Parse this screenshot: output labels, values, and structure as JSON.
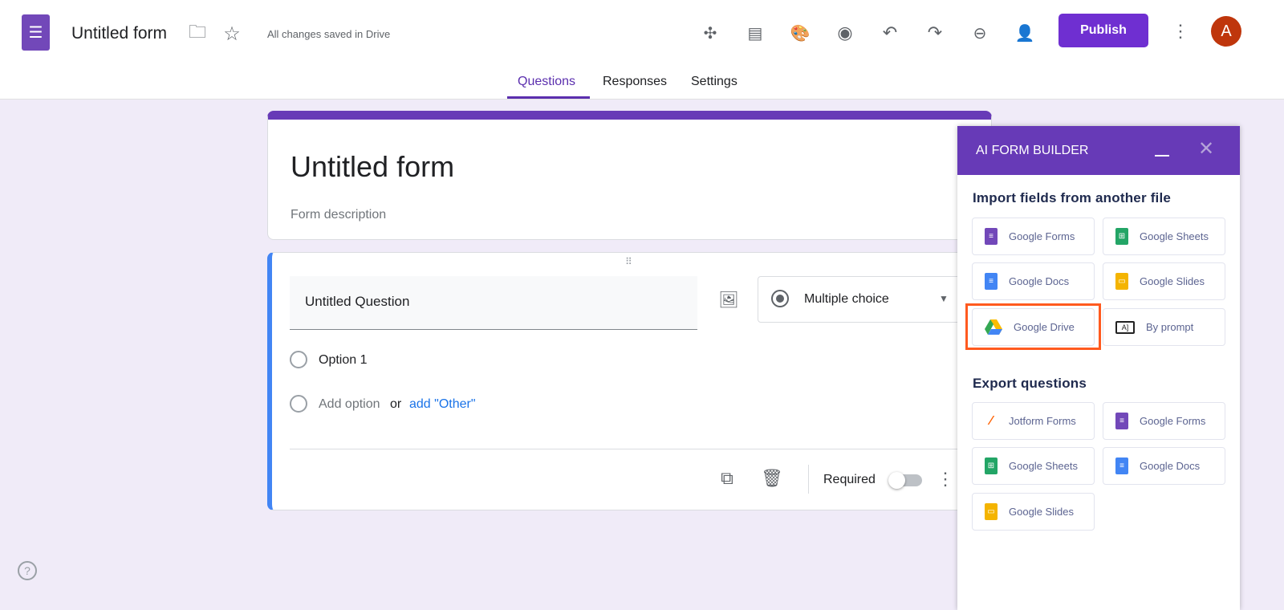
{
  "header": {
    "title": "Untitled form",
    "save_status": "All changes saved in Drive",
    "publish_label": "Publish",
    "avatar_letter": "A"
  },
  "tabs": [
    {
      "label": "Questions"
    },
    {
      "label": "Responses"
    },
    {
      "label": "Settings"
    }
  ],
  "form": {
    "title": "Untitled form",
    "description_placeholder": "Form description"
  },
  "question": {
    "title": "Untitled Question",
    "type": "Multiple choice",
    "options": [
      "Option 1"
    ],
    "add_option": "Add option",
    "or": "or",
    "add_other": "add \"Other\"",
    "required_label": "Required",
    "required": false
  },
  "panel": {
    "title": "AI FORM BUILDER",
    "import_heading": "Import fields from another file",
    "import": [
      {
        "label": "Google Forms",
        "color": "#7248b9"
      },
      {
        "label": "Google Sheets",
        "color": "#23a566"
      },
      {
        "label": "Google Docs",
        "color": "#4285f4"
      },
      {
        "label": "Google Slides",
        "color": "#f4b400"
      },
      {
        "label": "Google Drive",
        "color": "#34a853"
      },
      {
        "label": "By prompt",
        "color": "#222"
      }
    ],
    "export_heading": "Export questions",
    "export": [
      {
        "label": "Jotform Forms",
        "color": "#ff6100"
      },
      {
        "label": "Google Forms",
        "color": "#7248b9"
      },
      {
        "label": "Google Sheets",
        "color": "#23a566"
      },
      {
        "label": "Google Docs",
        "color": "#4285f4"
      },
      {
        "label": "Google Slides",
        "color": "#f4b400"
      }
    ]
  },
  "colors": {
    "accent": "#673ab7",
    "publish": "#6f2fd1",
    "highlight": "#ff5a1f"
  }
}
